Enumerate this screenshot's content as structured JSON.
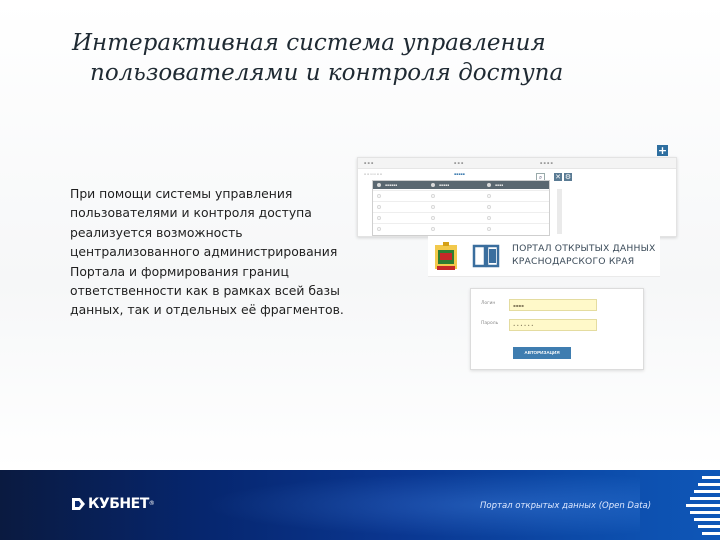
{
  "slide": {
    "title_line1": "Интерактивная система управления",
    "title_line2": "пользователями и контроля доступа",
    "body": "При помощи системы управления пользователями и контроля доступа реализуется возможность централизованного администрирования Портала и формирования границ ответственности как в рамках всей базы данных, так и отдельных её фрагментов."
  },
  "users_table": {
    "add_icon": "plus-icon",
    "search_icon": "search-icon",
    "close_icon": "close-icon",
    "settings_icon": "gear-icon",
    "rows_visible": 4
  },
  "portal": {
    "name_line1": "ПОРТАЛ ОТКРЫТЫХ ДАННЫХ",
    "name_line2": "КРАСНОДАРСКОГО КРАЯ",
    "crest_icon": "krasnodar-crest-icon",
    "logo_icon": "open-book-icon",
    "login_label": "Логин",
    "password_label": "Пароль",
    "login_button": "АВТОРИЗАЦИЯ"
  },
  "footer": {
    "brand": "КУБНЕТ",
    "brand_mark": "®",
    "caption": "Портал открытых данных (Open Data)"
  },
  "colors": {
    "footer_dark": "#0a1a40",
    "footer_light": "#0e57b8",
    "accent_blue": "#3f7db0",
    "input_yellow": "#fff9c9",
    "title_text": "#1f2a33"
  }
}
